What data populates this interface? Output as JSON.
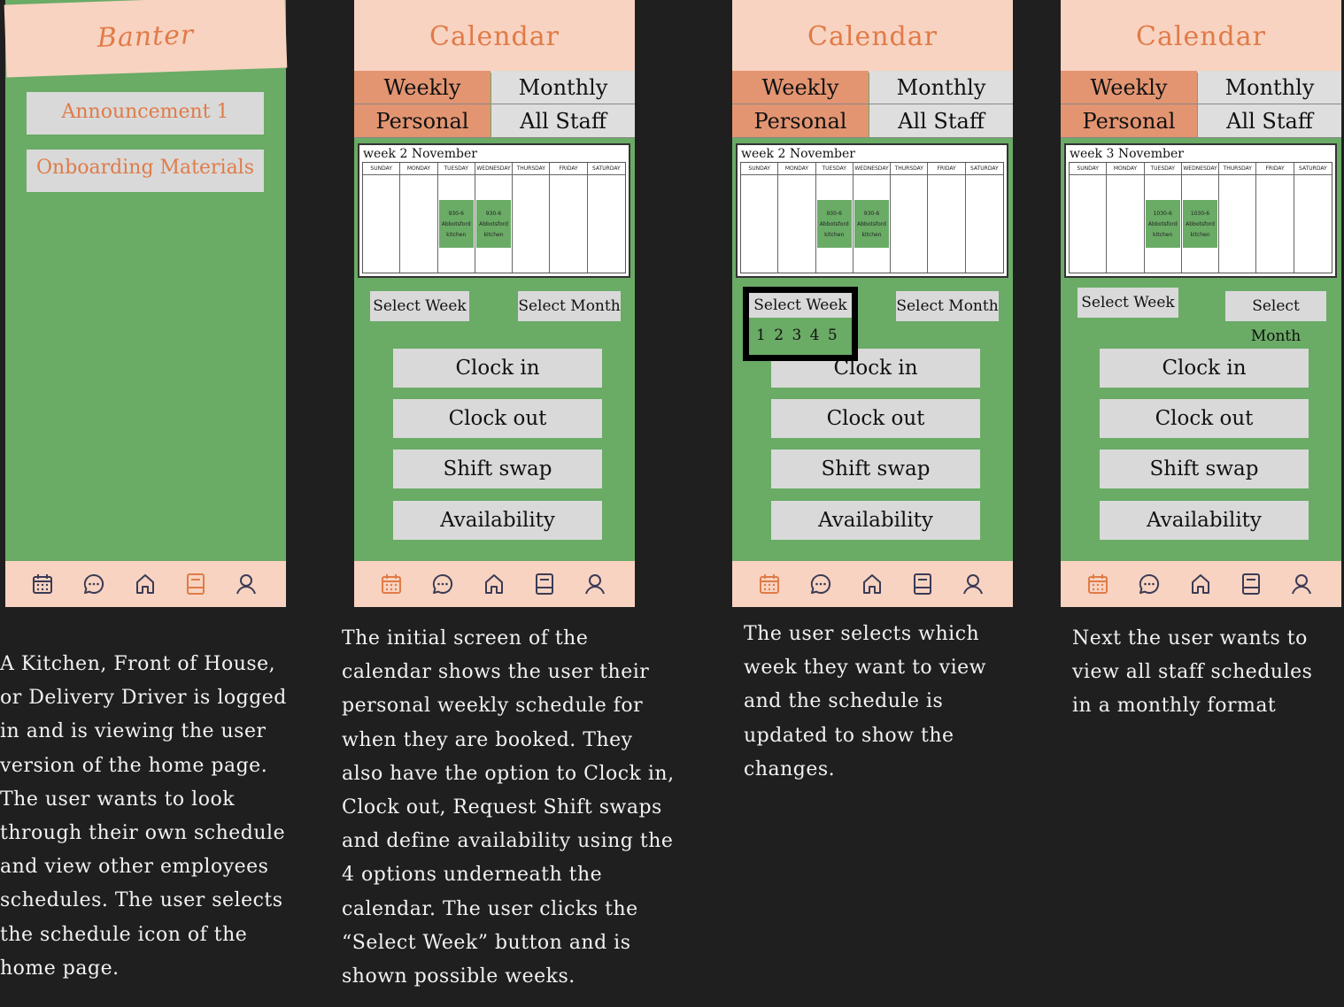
{
  "screen1": {
    "title": "Banter",
    "buttons": [
      "Announcement 1",
      "Onboarding Materials"
    ],
    "description": "A Kitchen, Front of House, or Delivery Driver is logged in and is viewing the user version of the home page. The user wants to look through their own schedule and view other employees schedules. The user selects the schedule icon of the home page."
  },
  "screen2": {
    "title": "Calendar",
    "tabs": [
      "Weekly",
      "Monthly",
      "Personal",
      "All Staff"
    ],
    "week_label": "week 2 November",
    "shifts": [
      "930-6 Abbotsford kitchen",
      "930-6 Abbotsford kitchen"
    ],
    "select_week": "Select Week",
    "select_month": "Select Month",
    "actions": [
      "Clock in",
      "Clock out",
      "Shift swap",
      "Availability"
    ],
    "description": "The initial screen of the calendar shows the user their personal weekly schedule for when they are booked. They also have the option to Clock in, Clock out, Request Shift swaps and define availability using the 4 options underneath the calendar. The user clicks the “Select Week” button and is shown possible weeks."
  },
  "screen3": {
    "title": "Calendar",
    "tabs": [
      "Weekly",
      "Monthly",
      "Personal",
      "All Staff"
    ],
    "week_label": "week 2 November",
    "shifts": [
      "930-6 Abbotsford kitchen",
      "930-6 Abbotsford kitchen"
    ],
    "select_week": "Select Week",
    "select_month": "Select Month",
    "week_options": "1 2 3 4 5",
    "actions": [
      "Clock in",
      "Clock out",
      "Shift swap",
      "Availability"
    ],
    "description": "The user selects which week they want to view and the schedule is updated to show the changes."
  },
  "screen4": {
    "title": "Calendar",
    "tabs": [
      "Weekly",
      "Monthly",
      "Personal",
      "All Staff"
    ],
    "week_label": "week 3 November",
    "shifts": [
      "1030-6 Abbotsford kitchen",
      "1030-6 Abbotsford kitchen"
    ],
    "select_week": "Select Week",
    "select_month": "Select Month",
    "actions": [
      "Clock in",
      "Clock out",
      "Shift swap",
      "Availability"
    ],
    "description": "Next the user wants to view all staff schedules in a monthly format"
  },
  "days": [
    "SUNDAY",
    "MONDAY",
    "TUESDAY",
    "WEDNESDAY",
    "THURSDAY",
    "FRIDAY",
    "SATURDAY"
  ],
  "nav_icons": [
    "calendar-icon",
    "chat-icon",
    "home-icon",
    "book-icon",
    "user-icon"
  ],
  "colors": {
    "green": "#6aab66",
    "peach": "#f8d3c1",
    "orange": "#e07b48",
    "tab_active": "#e39572",
    "button": "#d9d9d9",
    "background": "#1f1f1f"
  }
}
